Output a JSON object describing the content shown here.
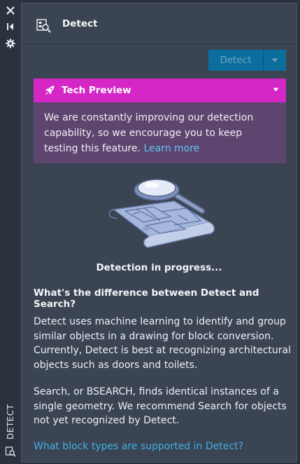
{
  "rail": {
    "close_icon": "close-icon",
    "collapse_icon": "collapse-icon",
    "settings_icon": "gear-icon",
    "vertical_label": "DETECT"
  },
  "header": {
    "title": "Detect",
    "icon": "detect-icon"
  },
  "toolbar": {
    "detect_label": "Detect",
    "dropdown_icon": "chevron-down-icon"
  },
  "tech_preview": {
    "title": "Tech Preview",
    "body_text": "We are constantly improving our detection capability, so we encourage you to keep testing this feature.",
    "link_text": "Learn more",
    "accent_color": "#d427c6"
  },
  "status": {
    "progress_text": "Detection in progress..."
  },
  "info": {
    "question": "What's the difference between Detect and Search?",
    "paragraph1": "Detect uses machine learning to identify and group similar objects in a drawing for block conversion. Currently, Detect is best at recognizing architectural objects such as doors and toilets.",
    "paragraph2": "Search, or BSEARCH, finds identical instances of a single geometry. We recommend Search for objects not yet recognized by Detect.",
    "bottom_link": "What block types are supported in Detect?"
  }
}
